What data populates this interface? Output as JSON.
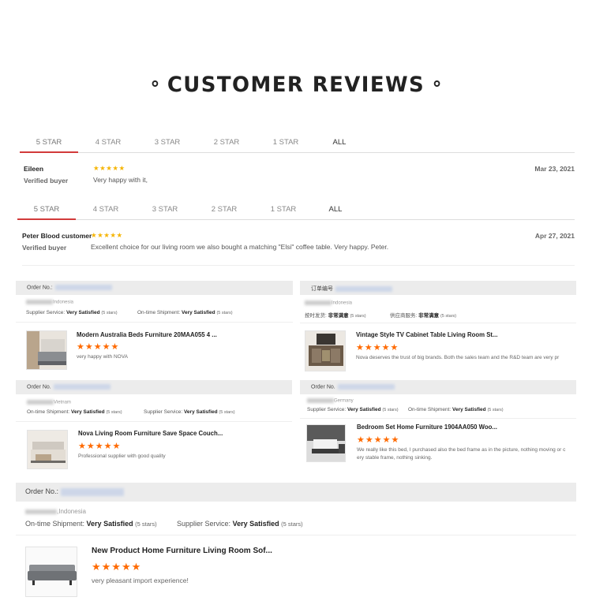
{
  "title": "CUSTOMER REVIEWS",
  "tabs1": [
    "5 STAR",
    "4 STAR",
    "3 STAR",
    "2 STAR",
    "1 STAR",
    "ALL"
  ],
  "tabs2": [
    "5 STAR",
    "4 STAR",
    "3 STAR",
    "2 STAR",
    "1 STAR",
    "ALL"
  ],
  "review1": {
    "name": "Eileen",
    "verified": "Verified buyer",
    "stars": "★★★★★",
    "text": "Very happy with it,",
    "date": "Mar 23, 2021"
  },
  "review2": {
    "name": "Peter Blood customer",
    "verified": "Verified buyer",
    "stars": "★★★★★",
    "text": "Excellent choice for our living room we also bought a matching \"Elsi\" coffee table. Very happy. Peter.",
    "date": "Apr 27, 2021"
  },
  "stars": "★★★★★",
  "orders": [
    {
      "order_label": "Order No.:",
      "country": "Indonesia",
      "svc1_label": "Supplier Service:",
      "svc1_value": "Very Satisfied",
      "svc1_count": "(5 stars)",
      "svc2_label": "On-time Shipment:",
      "svc2_value": "Very Satisfied",
      "svc2_count": "(5 stars)",
      "product": "Modern Australia Beds Furniture 20MAA055 4 ...",
      "comment": "very happy with NOVA"
    },
    {
      "order_label": "订单编号",
      "country": "Indonesia",
      "svc1_label": "按时发货:",
      "svc1_value": "非常满意",
      "svc1_count": "(5 stars)",
      "svc2_label": "供应商服务:",
      "svc2_value": "非常满意",
      "svc2_count": "(5 stars)",
      "product": "Vintage Style TV Cabinet Table Living Room St...",
      "comment": "Nova deserves the trust of big brands. Both the sales team and the R&D team are very pr"
    },
    {
      "order_label": "Order No.",
      "country": "Vietnam",
      "svc1_label": "On-time Shipment:",
      "svc1_value": "Very Satisfied",
      "svc1_count": "(5 stars)",
      "svc2_label": "Supplier Service:",
      "svc2_value": "Very Satisfied",
      "svc2_count": "(5 stars)",
      "product": "Nova Living Room Furniture Save Space Couch...",
      "comment": "Professional supplier with good quality"
    },
    {
      "order_label": "Order No.",
      "country": "Germany",
      "svc1_label": "Supplier Service:",
      "svc1_value": "Very Satisfied",
      "svc1_count": "(5 stars)",
      "svc2_label": "On-time Shipment:",
      "svc2_value": "Very Satisfied",
      "svc2_count": "(5 stars)",
      "product": "Bedroom Set Home Furniture 1904AA050 Woo...",
      "comment": "We really like this bed, I purchased also the bed frame as in the picture, nothing moving or c",
      "comment2": "ery stable frame, nothing sinking."
    },
    {
      "order_label": "Order No.:",
      "country": ",Indonesia",
      "svc1_label": "On-time Shipment:",
      "svc1_value": "Very Satisfied",
      "svc1_count": "(5 stars)",
      "svc2_label": "Supplier Service:",
      "svc2_value": "Very Satisfied",
      "svc2_count": "(5 stars)",
      "product": "New Product Home Furniture Living Room Sof...",
      "comment": "very pleasant import experience!"
    }
  ]
}
